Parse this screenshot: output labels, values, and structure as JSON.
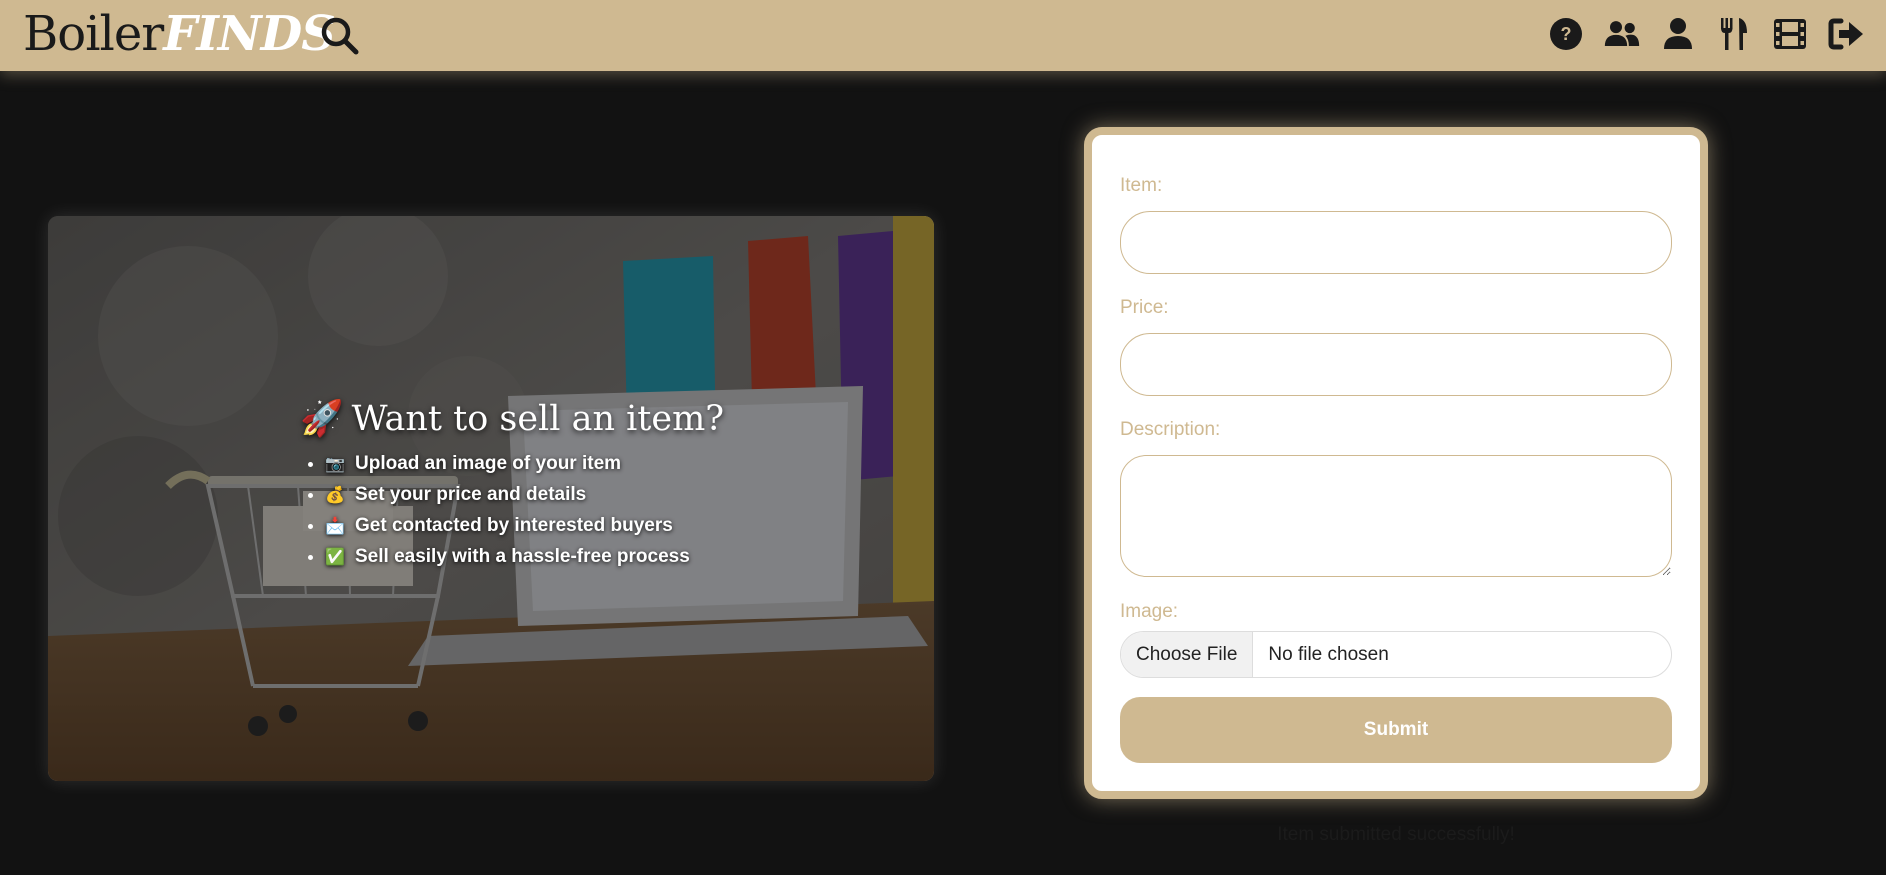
{
  "header": {
    "logo_plain": "Boiler",
    "logo_bold": "FINDS",
    "nav_icons": [
      "help-icon",
      "users-icon",
      "profile-icon",
      "dining-icon",
      "film-icon",
      "logout-icon"
    ]
  },
  "hero": {
    "title_emoji": "🚀",
    "title": "Want to sell an item?",
    "items": [
      {
        "emoji": "📷",
        "text": "Upload an image of your item"
      },
      {
        "emoji": "💰",
        "text": "Set your price and details"
      },
      {
        "emoji": "📩",
        "text": "Get contacted by interested buyers"
      },
      {
        "emoji": "✅",
        "text": "Sell easily with a hassle-free process"
      }
    ]
  },
  "form": {
    "item_label": "Item:",
    "price_label": "Price:",
    "description_label": "Description:",
    "image_label": "Image:",
    "file_button": "Choose File",
    "file_status": "No file chosen",
    "submit_label": "Submit"
  },
  "status_message": "Item submitted successfully!",
  "colors": {
    "accent": "#cfb991",
    "background": "#121212",
    "card": "#ffffff"
  }
}
